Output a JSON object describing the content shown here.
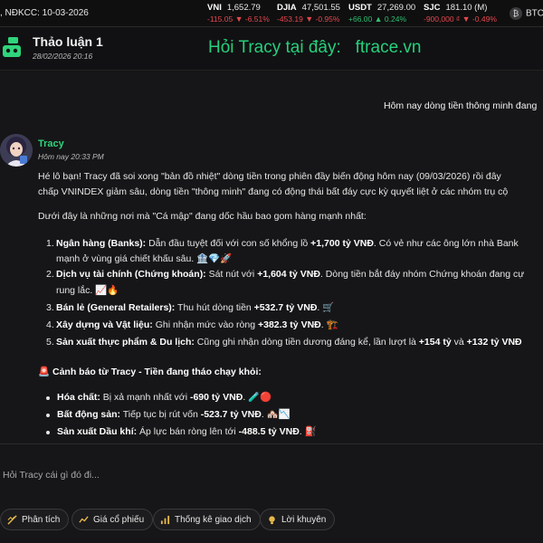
{
  "ticker": {
    "date_label": ", NĐKCC: 10-03-2026",
    "items": [
      {
        "name": "VNI",
        "value": "1,652.79",
        "change": "-115.05",
        "pct": "-6.51%",
        "dir": "down"
      },
      {
        "name": "DJIA",
        "value": "47,501.55",
        "change": "-453.19",
        "pct": "-0.95%",
        "dir": "down"
      },
      {
        "name": "USDT",
        "value": "27,269.00",
        "change": "+66.00",
        "pct": "0.24%",
        "dir": "up"
      },
      {
        "name": "SJC",
        "value": "181.10 (M)",
        "change": "-900,000 ₫",
        "pct": "-0.49%",
        "dir": "down"
      }
    ],
    "btc_label": "BTC"
  },
  "header": {
    "title": "Thảo luận 1",
    "date": "28/02/2026 20:16",
    "promo": "Hỏi Tracy tại đây:   ftrace.vn"
  },
  "user_message": "Hôm nay dòng tiền thông minh đang",
  "assistant": {
    "name": "Tracy",
    "time": "Hôm nay 20:33 PM",
    "intro_line1": "Hé lô bạn! Tracy đã soi xong \"bản đồ nhiệt\" dòng tiền trong phiên đầy biến động hôm nay (09/03/2026) rồi đây",
    "intro_line2": "chấp VNINDEX giảm sâu, dòng tiền \"thông minh\" đang có động thái bất đáy cực kỳ quyết liệt ở các nhóm trụ cộ",
    "lead": "Dưới đây là những nơi mà \"Cá mập\" đang dốc hầu bao gom hàng mạnh nhất:",
    "list": [
      {
        "num": "1.",
        "label": "Ngân hàng (Banks):",
        "text": " Dẫn đầu tuyệt đối với con số khổng lồ ",
        "value": "+1,700 tỷ VNĐ",
        "after": ". Có vẻ như các ông lớn nhà Bank"
      },
      {
        "num": "",
        "label": "",
        "text": "mạnh ở vùng giá chiết khấu sâu. 🏦💎🚀",
        "value": "",
        "after": ""
      },
      {
        "num": "2.",
        "label": "Dịch vụ tài chính (Chứng khoán):",
        "text": " Sát nút với ",
        "value": "+1,604 tỷ VNĐ",
        "after": ". Dòng tiền bắt đáy nhóm Chứng khoán đang cự"
      },
      {
        "num": "",
        "label": "",
        "text": "rung lắc. 📈🔥",
        "value": "",
        "after": ""
      },
      {
        "num": "3.",
        "label": "Bán lẻ (General Retailers):",
        "text": " Thu hút dòng tiền ",
        "value": "+532.7 tỷ VNĐ",
        "after": ". 🛒"
      },
      {
        "num": "4.",
        "label": "Xây dựng và Vật liệu:",
        "text": " Ghi nhận mức vào ròng ",
        "value": "+382.3 tỷ VNĐ",
        "after": ". 🏗️"
      },
      {
        "num": "5.",
        "label": "Sản xuất thực phẩm & Du lịch:",
        "text": " Cũng ghi nhận dòng tiền dương đáng kể, lần lượt là ",
        "value": "+154 tỷ",
        "after": " và ",
        "value2": "+132 tỷ VNĐ"
      }
    ],
    "warning": "🚨 Cảnh báo từ Tracy - Tiền đang tháo chạy khỏi:",
    "bullets": [
      {
        "label": "Hóa chất:",
        "text": " Bị xả mạnh nhất với ",
        "value": "-690 tỷ VNĐ",
        "after": ". 🧪🔴"
      },
      {
        "label": "Bất động sản:",
        "text": " Tiếp tục bị rút vốn ",
        "value": "-523.7 tỷ VNĐ",
        "after": ". 🏘️📉"
      },
      {
        "label": "Sản xuất Dầu khí:",
        "text": " Áp lực bán ròng lên tới ",
        "value": "-488.5 tỷ VNĐ",
        "after": ". ⛽"
      }
    ]
  },
  "input": {
    "placeholder": "Hỏi Tracy cái gì đó đi..."
  },
  "chips": [
    {
      "label": "Phân tích",
      "icon": "chart-bar-icon"
    },
    {
      "label": "Giá cổ phiếu",
      "icon": "trend-line-icon"
    },
    {
      "label": "Thống kê giao dịch",
      "icon": "stats-bars-icon"
    },
    {
      "label": "Lời khuyên",
      "icon": "lightbulb-icon"
    }
  ],
  "colors": {
    "accent": "#2fd47b",
    "down": "#e5484d",
    "up": "#2fbf71",
    "background": "#161618"
  }
}
